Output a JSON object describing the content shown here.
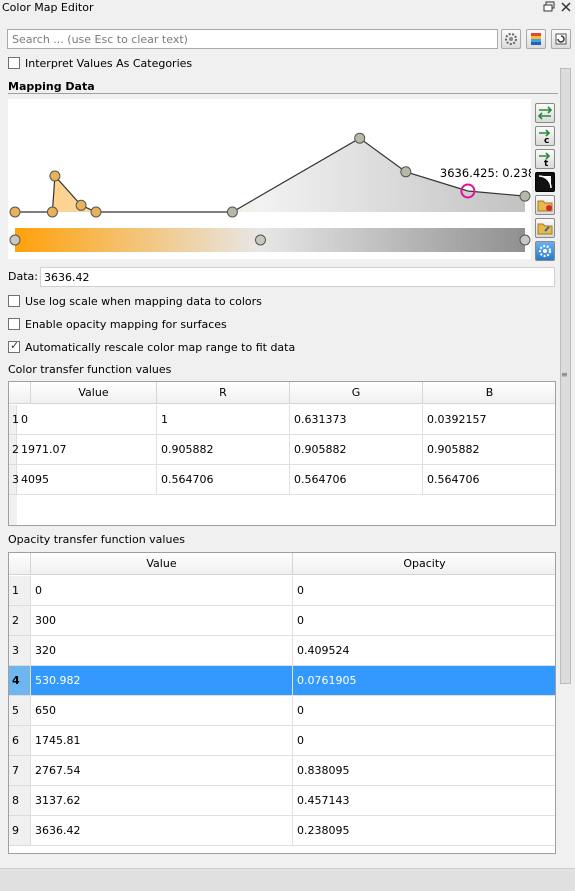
{
  "window": {
    "title": "Color Map Editor"
  },
  "search": {
    "placeholder": "Search ... (use Esc to clear text)"
  },
  "toolbar": {
    "icons": [
      "gear-icon",
      "palette-icon",
      "restore-icon"
    ]
  },
  "options": {
    "interpret_categories": {
      "label": "Interpret Values As Categories",
      "checked": false
    },
    "log_scale": {
      "label": "Use log scale when mapping data to colors",
      "checked": false
    },
    "opacity_mapping": {
      "label": "Enable opacity mapping for surfaces",
      "checked": false
    },
    "auto_rescale": {
      "label": "Automatically rescale color map range to fit data",
      "checked": true
    }
  },
  "mapping": {
    "section_title": "Mapping Data",
    "tooltip": "3636.425: 0.238",
    "range": [
      0,
      4095
    ],
    "opacity_points": [
      [
        0,
        0
      ],
      [
        300,
        0
      ],
      [
        320,
        0.409524
      ],
      [
        530.982,
        0.0761905
      ],
      [
        650,
        0
      ],
      [
        1745.81,
        0
      ],
      [
        2767.54,
        0.838095
      ],
      [
        3137.62,
        0.457143
      ],
      [
        3636.42,
        0.238095
      ],
      [
        4095,
        0.181
      ]
    ],
    "selected_opacity_point": 8,
    "color_points": [
      {
        "value": 0,
        "color": "#ffa10a"
      },
      {
        "value": 1971.07,
        "color": "#e7e7e7"
      },
      {
        "value": 4095,
        "color": "#909090"
      }
    ],
    "side_buttons": [
      "rescale-range-icon",
      "rescale-custom-icon",
      "rescale-visible-icon",
      "invert-icon",
      "save-preset-icon",
      "choose-preset-icon",
      "advanced-settings-icon"
    ]
  },
  "data_field": {
    "label": "Data:",
    "value": "3636.42"
  },
  "color_table": {
    "label": "Color transfer function values",
    "headers": [
      "Value",
      "R",
      "G",
      "B"
    ],
    "rows": [
      {
        "num": "1",
        "cells": [
          "0",
          "1",
          "0.631373",
          "0.0392157"
        ]
      },
      {
        "num": "2",
        "cells": [
          "1971.07",
          "0.905882",
          "0.905882",
          "0.905882"
        ]
      },
      {
        "num": "3",
        "cells": [
          "4095",
          "0.564706",
          "0.564706",
          "0.564706"
        ]
      }
    ]
  },
  "opacity_table": {
    "label": "Opacity transfer function values",
    "headers": [
      "Value",
      "Opacity"
    ],
    "selected_row": 3,
    "rows": [
      {
        "num": "1",
        "cells": [
          "0",
          "0"
        ]
      },
      {
        "num": "2",
        "cells": [
          "300",
          "0"
        ]
      },
      {
        "num": "3",
        "cells": [
          "320",
          "0.409524"
        ]
      },
      {
        "num": "4",
        "cells": [
          "530.982",
          "0.0761905"
        ]
      },
      {
        "num": "5",
        "cells": [
          "650",
          "0"
        ]
      },
      {
        "num": "6",
        "cells": [
          "1745.81",
          "0"
        ]
      },
      {
        "num": "7",
        "cells": [
          "2767.54",
          "0.838095"
        ]
      },
      {
        "num": "8",
        "cells": [
          "3137.62",
          "0.457143"
        ]
      },
      {
        "num": "9",
        "cells": [
          "3636.42",
          "0.238095"
        ]
      }
    ]
  }
}
